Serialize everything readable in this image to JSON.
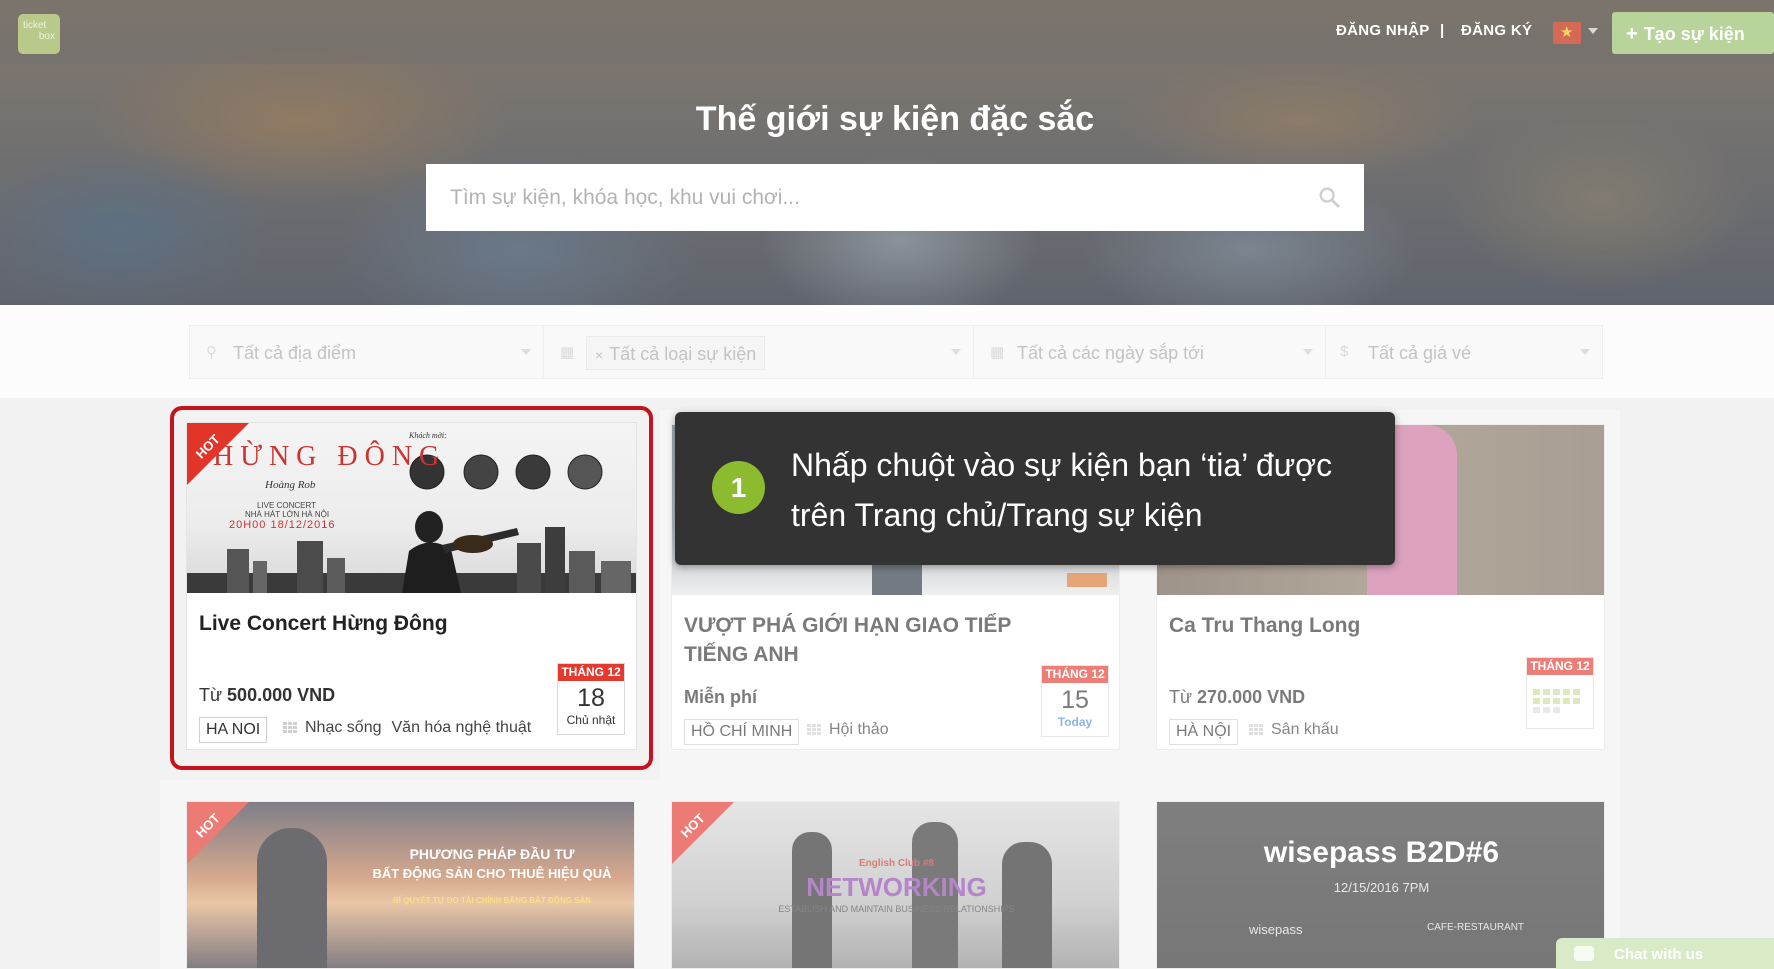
{
  "header": {
    "login": "ĐĂNG NHẬP",
    "separator": "|",
    "register": "ĐĂNG KÝ",
    "create_event": "Tạo sự kiện",
    "logo_line1": "ticket",
    "logo_line2": "box"
  },
  "hero": {
    "title": "Thế giới sự kiện đặc sắc",
    "search_placeholder": "Tìm sự kiện, khóa học, khu vui chơi..."
  },
  "filters": {
    "location": "Tất cả địa điểm",
    "category": "Tất cả loại sự kiện",
    "date": "Tất cả các ngày sắp tới",
    "price": "Tất cả giá vé"
  },
  "events": [
    {
      "hot": "HOT",
      "title": "Live Concert Hừng Đông",
      "price_prefix": "Từ ",
      "price": "500.000 VND",
      "city": "HA NOI",
      "cat1": "Nhạc sống",
      "cat2": "Văn hóa nghệ thuật",
      "month": "THÁNG 12",
      "day": "18",
      "weekday": "Chủ nhật",
      "poster_title": "HỪNG ĐÔNG",
      "poster_sub": "Hoàng Rob",
      "poster_line1": "LIVE CONCERT",
      "poster_line2": "NHÀ HÁT LỚN HÀ NỘI",
      "poster_date": "20H00 18/12/2016",
      "poster_guest": "Khách mời:"
    },
    {
      "title": "VƯỢT PHÁ GIỚI HẠN GIAO TIẾP TIẾNG ANH",
      "price": "Miễn phí",
      "city": "HỒ CHÍ MINH",
      "cat1": "Hội thảo",
      "month": "THÁNG 12",
      "day": "15",
      "weekday": "Today"
    },
    {
      "title": "Ca Tru Thang Long",
      "price_prefix": "Từ ",
      "price": "270.000 VND",
      "city": "HÀ NỘI",
      "cat1": "Sân khấu",
      "month": "THÁNG 12"
    },
    {
      "hot": "HOT",
      "poster_line1": "PHƯƠNG PHÁP ĐẦU TƯ",
      "poster_line2": "BẤT ĐỘNG SẢN CHO THUÊ HIỆU QUẢ",
      "poster_line3": "BÍ QUYẾT TỰ DO TÀI CHÍNH BẰNG BẤT ĐỘNG SẢN"
    },
    {
      "hot": "HOT",
      "poster_small": "English Club #8",
      "poster_title": "NETWORKING",
      "poster_sub": "ESTABLISH AND MAINTAIN BUSINESS RELATIONSHIPS"
    },
    {
      "poster_title": "wisepass B2D#6",
      "poster_date": "12/15/2016 7PM",
      "poster_brand": "wisepass",
      "poster_venue": "CAFE-RESTAURANT"
    }
  ],
  "tooltip": {
    "step": "1",
    "text": "Nhấp chuột vào sự kiện bạn ‘tia’ được trên Trang chủ/Trang sự kiện"
  },
  "chat": {
    "label": "Chat with us"
  },
  "colors": {
    "hot_red": "#e1352a",
    "highlight_red": "#c6131b",
    "step_green": "#8dbb2f",
    "tooltip_bg": "#333333",
    "create_button": "#b9d49a"
  }
}
